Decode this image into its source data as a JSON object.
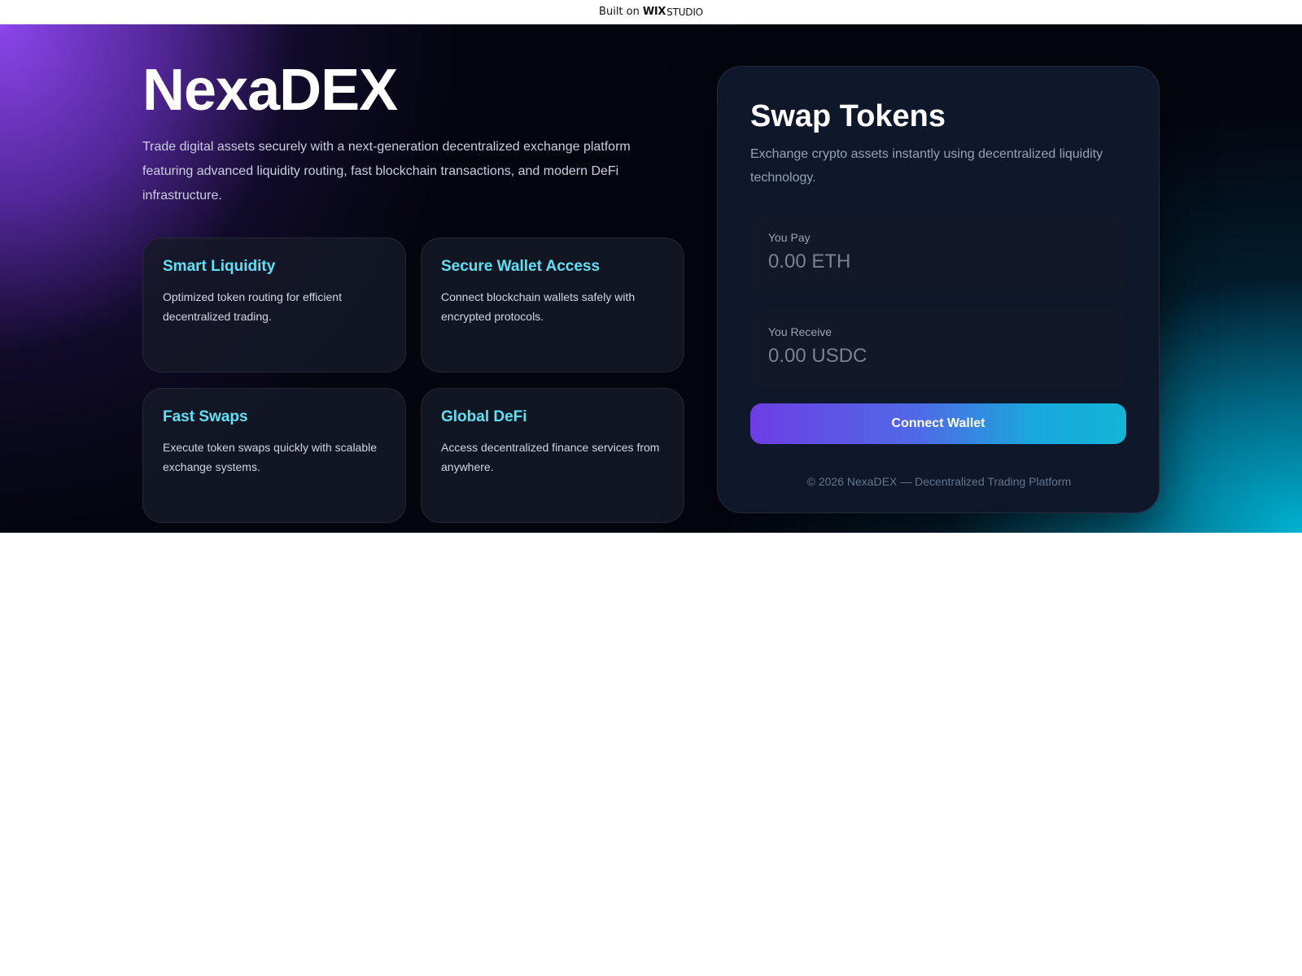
{
  "wix_banner": {
    "built_on": "Built on",
    "wix": "WIX",
    "studio": "STUDIO"
  },
  "hero": {
    "title": "NexaDEX",
    "description": "Trade digital assets securely with a next-generation decentralized exchange platform featuring advanced liquidity routing, fast blockchain transactions, and modern DeFi infrastructure."
  },
  "features": [
    {
      "title": "Smart Liquidity",
      "text": "Optimized token routing for efficient decentralized trading."
    },
    {
      "title": "Secure Wallet Access",
      "text": "Connect blockchain wallets safely with encrypted protocols."
    },
    {
      "title": "Fast Swaps",
      "text": "Execute token swaps quickly with scalable exchange systems."
    },
    {
      "title": "Global DeFi",
      "text": "Access decentralized finance services from anywhere."
    }
  ],
  "swap": {
    "title": "Swap Tokens",
    "subtitle": "Exchange crypto assets instantly using decentralized liquidity technology.",
    "pay": {
      "label": "You Pay",
      "placeholder": "0.00 ETH",
      "value": ""
    },
    "receive": {
      "label": "You Receive",
      "placeholder": "0.00 USDC",
      "value": ""
    },
    "button_label": "Connect Wallet",
    "footer": "© 2026 NexaDEX — Decentralized Trading Platform"
  },
  "colors": {
    "accent_cyan": "#5ee0f5",
    "gradient_purple": "#6d3ee6",
    "gradient_cyan": "#12b5d6",
    "card_background": "#0f172a"
  }
}
